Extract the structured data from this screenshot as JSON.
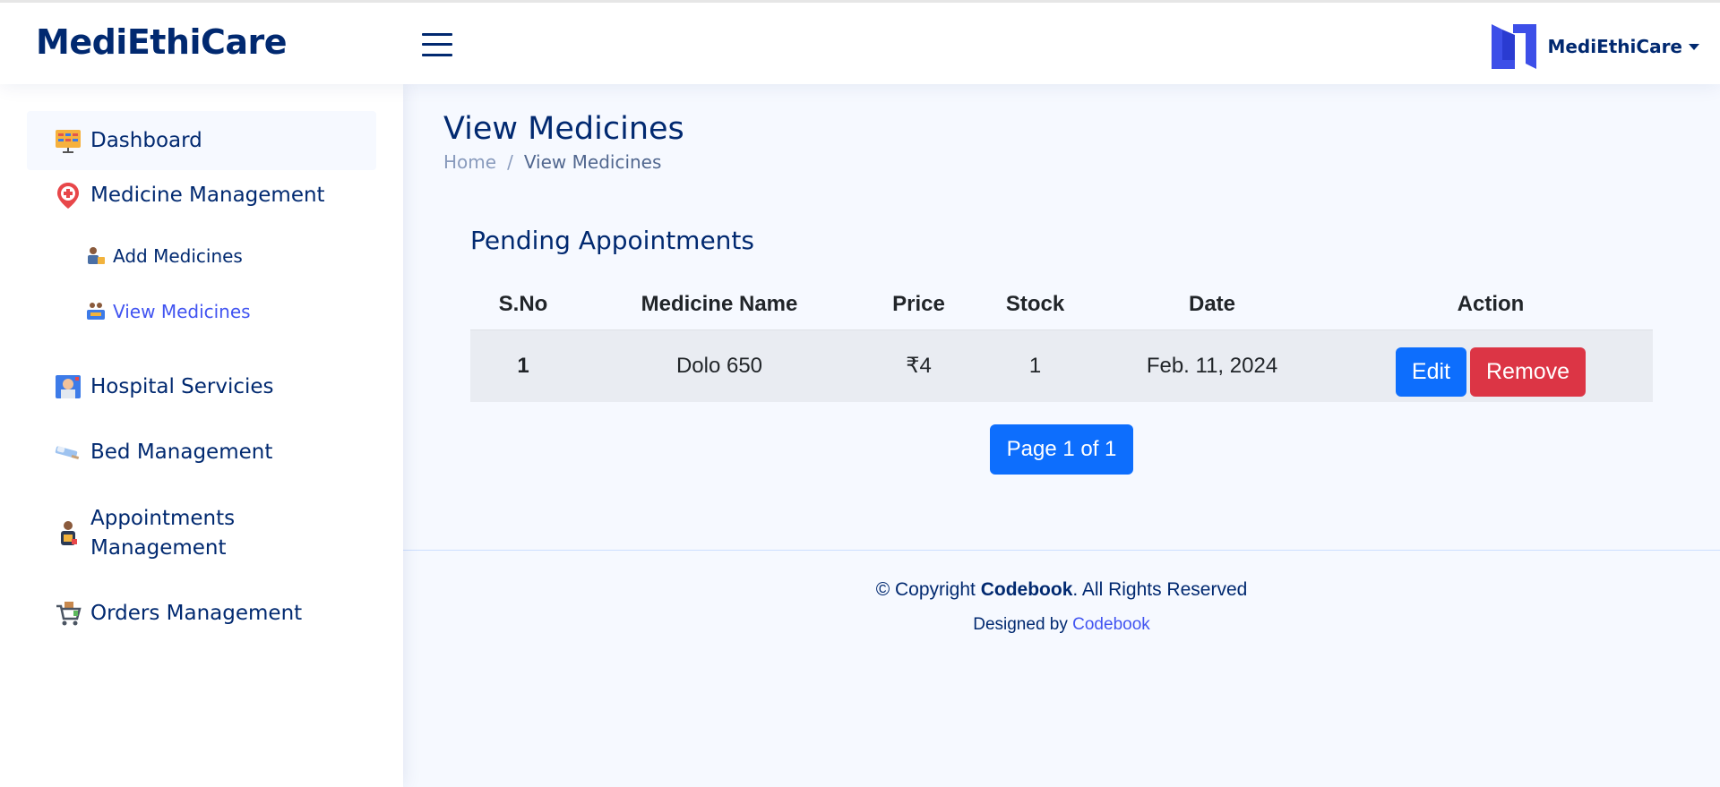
{
  "header": {
    "logo": "MediEthiCare",
    "profile_name": "MediEthiCare"
  },
  "sidebar": {
    "items": [
      {
        "label": "Dashboard",
        "icon": "dashboard-icon"
      },
      {
        "label": "Medicine Management",
        "icon": "medicine-pin-icon"
      },
      {
        "label": "Add Medicines",
        "icon": "add-medicines-icon"
      },
      {
        "label": "View Medicines",
        "icon": "view-medicines-icon"
      },
      {
        "label": "Hospital Servicies",
        "icon": "hospital-services-icon"
      },
      {
        "label": "Bed Management",
        "icon": "bed-icon"
      },
      {
        "label": "Appointments Management",
        "icon": "appointments-icon"
      },
      {
        "label": "Orders Management",
        "icon": "cart-icon"
      }
    ]
  },
  "page": {
    "title": "View Medicines",
    "breadcrumb": {
      "home": "Home",
      "separator": "/",
      "current": "View Medicines"
    },
    "section_title": "Pending Appointments"
  },
  "table": {
    "headers": [
      "S.No",
      "Medicine Name",
      "Price",
      "Stock",
      "Date",
      "Action"
    ],
    "rows": [
      {
        "sno": "1",
        "name": "Dolo 650",
        "price": "₹4",
        "stock": "1",
        "date": "Feb. 11, 2024",
        "edit_label": "Edit",
        "remove_label": "Remove"
      }
    ]
  },
  "pagination": {
    "label": "Page 1 of 1"
  },
  "footer": {
    "copyright_prefix": "© Copyright ",
    "copyright_owner": "Codebook",
    "copyright_suffix": ". All Rights Reserved",
    "designed_by": "Designed by ",
    "designer": "Codebook"
  },
  "colors": {
    "primary": "#012970",
    "accent": "#4154f1",
    "button_blue": "#0d6efd",
    "button_red": "#dc3545",
    "background": "#f6f9ff"
  }
}
